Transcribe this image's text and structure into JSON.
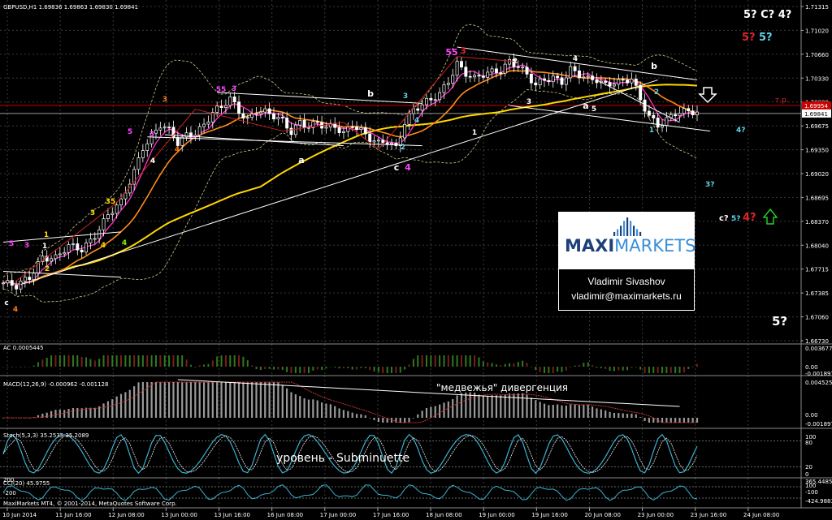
{
  "chart_data": [
    {
      "type": "candlestick",
      "symbol_header": "GBPUSD,H1  1.69836 1.69863 1.69830 1.69841",
      "ylim": [
        1.6673,
        1.7135
      ],
      "price_ticks": [
        "1.71315",
        "1.71020",
        "1.70660",
        "1.70330",
        "1.70000",
        "1.69675",
        "1.69350",
        "1.69020",
        "1.68695",
        "1.68370",
        "1.68040",
        "1.67715",
        "1.67385",
        "1.67060",
        "1.66730"
      ],
      "current_price_label": "1.69841",
      "tp_price_label": "1.69954",
      "tp_label": "т.р.",
      "x_ticks": [
        "10 Jun 2014",
        "11 Jun 16:00",
        "12 Jun 08:00",
        "13 Jun 00:00",
        "13 Jun 16:00",
        "16 Jun 08:00",
        "17 Jun 00:00",
        "17 Jun 16:00",
        "18 Jun 08:00",
        "19 Jun 00:00",
        "19 Jun 16:00",
        "20 Jun 08:00",
        "23 Jun 00:00",
        "23 Jun 16:00",
        "24 Jun 08:00"
      ],
      "close_path": [
        [
          0,
          1.6752
        ],
        [
          3,
          1.6745
        ],
        [
          6,
          1.676
        ],
        [
          9,
          1.679
        ],
        [
          12,
          1.6786
        ],
        [
          15,
          1.68
        ],
        [
          18,
          1.6798
        ],
        [
          21,
          1.682
        ],
        [
          24,
          1.6845
        ],
        [
          27,
          1.686
        ],
        [
          30,
          1.6905
        ],
        [
          32,
          1.694
        ],
        [
          34,
          1.6955
        ],
        [
          36,
          1.6968
        ],
        [
          38,
          1.6958
        ],
        [
          40,
          1.6942
        ],
        [
          42,
          1.6955
        ],
        [
          44,
          1.696
        ],
        [
          46,
          1.697
        ],
        [
          48,
          1.6985
        ],
        [
          50,
          1.699
        ],
        [
          52,
          1.7003
        ],
        [
          54,
          1.6988
        ],
        [
          56,
          1.6978
        ],
        [
          58,
          1.699
        ],
        [
          60,
          1.6985
        ],
        [
          62,
          1.6978
        ],
        [
          64,
          1.6972
        ],
        [
          66,
          1.696
        ],
        [
          68,
          1.6975
        ],
        [
          70,
          1.6968
        ],
        [
          72,
          1.697
        ],
        [
          74,
          1.6962
        ],
        [
          76,
          1.6965
        ],
        [
          78,
          1.6958
        ],
        [
          80,
          1.6972
        ],
        [
          82,
          1.6962
        ],
        [
          84,
          1.6948
        ],
        [
          86,
          1.694
        ],
        [
          88,
          1.6945
        ],
        [
          90,
          1.6938
        ],
        [
          92,
          1.6975
        ],
        [
          94,
          1.699
        ],
        [
          96,
          1.6995
        ],
        [
          98,
          1.7
        ],
        [
          100,
          1.701
        ],
        [
          102,
          1.703
        ],
        [
          104,
          1.7055
        ],
        [
          106,
          1.704
        ],
        [
          108,
          1.703
        ],
        [
          110,
          1.7035
        ],
        [
          112,
          1.704
        ],
        [
          114,
          1.7045
        ],
        [
          116,
          1.7058
        ],
        [
          118,
          1.705
        ],
        [
          120,
          1.7035
        ],
        [
          122,
          1.702
        ],
        [
          124,
          1.703
        ],
        [
          126,
          1.7035
        ],
        [
          128,
          1.703
        ],
        [
          130,
          1.7045
        ],
        [
          132,
          1.7035
        ],
        [
          134,
          1.7028
        ],
        [
          136,
          1.703
        ],
        [
          138,
          1.7025
        ],
        [
          140,
          1.703
        ],
        [
          142,
          1.7028
        ],
        [
          144,
          1.703
        ],
        [
          146,
          1.7
        ],
        [
          148,
          1.698
        ],
        [
          150,
          1.697
        ],
        [
          152,
          1.6978
        ],
        [
          154,
          1.6985
        ],
        [
          156,
          1.6984
        ]
      ],
      "overlay_labels": [
        {
          "text": "5? C? 4?",
          "color": "#ffffff"
        },
        {
          "text": "5?",
          "color": "#e0242a"
        },
        {
          "text": "5?",
          "color": "#5fd3e6"
        },
        {
          "text": "5?",
          "color": "#ffffff"
        },
        {
          "text": "4?",
          "color": "#5fd3e6"
        },
        {
          "text": "3?",
          "color": "#5fd3e6"
        },
        {
          "text": "c?",
          "color": "#ffffff"
        },
        {
          "text": "5?",
          "color": "#5fd3e6"
        },
        {
          "text": "4?",
          "color": "#e0242a"
        }
      ],
      "wave_labels": [
        {
          "text": "c",
          "color": "#ffffff"
        },
        {
          "text": "4",
          "color": "#ff7a1a"
        },
        {
          "text": "1",
          "color": "#ffd700"
        },
        {
          "text": "2",
          "color": "#ffd700"
        },
        {
          "text": "3",
          "color": "#ff44ff"
        },
        {
          "text": "5",
          "color": "#ff44ff"
        },
        {
          "text": "3",
          "color": "#ffd700"
        },
        {
          "text": "4",
          "color": "#ffd700"
        },
        {
          "text": "35",
          "color": "#ffd700"
        },
        {
          "text": "4",
          "color": "#7cfc00"
        },
        {
          "text": "1",
          "color": "#ffffff"
        },
        {
          "text": "3",
          "color": "#ff44ff"
        },
        {
          "text": "5",
          "color": "#ff44ff"
        },
        {
          "text": "4",
          "color": "#ffffff"
        },
        {
          "text": "3",
          "color": "#ff7a1a"
        },
        {
          "text": "55",
          "color": "#ff44ff"
        },
        {
          "text": "3",
          "color": "#ff44ff"
        },
        {
          "text": "4",
          "color": "#ff7a1a"
        },
        {
          "text": "a",
          "color": "#ffffff"
        },
        {
          "text": "b",
          "color": "#ffffff"
        },
        {
          "text": "c",
          "color": "#ffffff"
        },
        {
          "text": "4",
          "color": "#ff44ff"
        },
        {
          "text": "3",
          "color": "#5fd3e6"
        },
        {
          "text": "2",
          "color": "#5fd3e6"
        },
        {
          "text": "4",
          "color": "#5fd3e6"
        },
        {
          "text": "55",
          "color": "#ff44ff"
        },
        {
          "text": "3",
          "color": "#e0242a"
        },
        {
          "text": "1",
          "color": "#ffffff"
        },
        {
          "text": "2",
          "color": "#ffffff"
        },
        {
          "text": "3",
          "color": "#ffffff"
        },
        {
          "text": "4",
          "color": "#ffffff"
        },
        {
          "text": "a",
          "color": "#ffffff"
        },
        {
          "text": "5",
          "color": "#ffffff"
        },
        {
          "text": "b",
          "color": "#ffffff"
        },
        {
          "text": "2",
          "color": "#5fd3e6"
        },
        {
          "text": "1",
          "color": "#5fd3e6"
        }
      ]
    },
    {
      "type": "histogram",
      "title": "AC 0.0005445",
      "ticks": [
        "0.003677",
        "0.00",
        "-0.001897"
      ]
    },
    {
      "type": "histogram",
      "title": "MACD(12,26,9) -0.000962 -0.001128",
      "annotation": "\"медвежья\" дивергенция",
      "ticks": [
        "0.004525",
        "0.00",
        "-0.001897"
      ]
    },
    {
      "type": "line",
      "title": "Stoch(5,3,3) 35.2535 35.2089",
      "annotation": "уровень - Subminuette",
      "ticks": [
        "100",
        "80",
        "20",
        "0"
      ]
    },
    {
      "type": "line",
      "title": "CCI(20) 45.9755",
      "ticks": [
        "365.4485",
        "100",
        "-100",
        "-424.9883"
      ],
      "left_ticks": [
        "200",
        "-200"
      ]
    }
  ],
  "footer": {
    "copyright": "MaxiMarkets MT4, © 2001-2014, MetaQuotes Software Corp."
  },
  "logo": {
    "name": "MAXIMARKETS"
  },
  "contact": {
    "name": "Vladimir Sivashov",
    "email": "vladimir@maximarkets.ru"
  },
  "colors": {
    "background": "#000000",
    "grid": "#3a3a3a",
    "separator": "#8a8a8a",
    "ma_long": "#ffd700",
    "ma_mid": "#ff8c1a",
    "ma_fast": "#ff33cc",
    "envelope": "#cccc88",
    "trend": "#ffffff",
    "tp_line": "#cc0000",
    "current_line": "#ffffff",
    "candle": "#ffffff",
    "histogram": "#4a8a2a",
    "macd_signal": "#cc3333",
    "stoch_main": "#3ab3d0",
    "stoch_signal": "#f0f0f0",
    "cci": "#3ab3d0",
    "arrow_up": "#22cc22"
  }
}
